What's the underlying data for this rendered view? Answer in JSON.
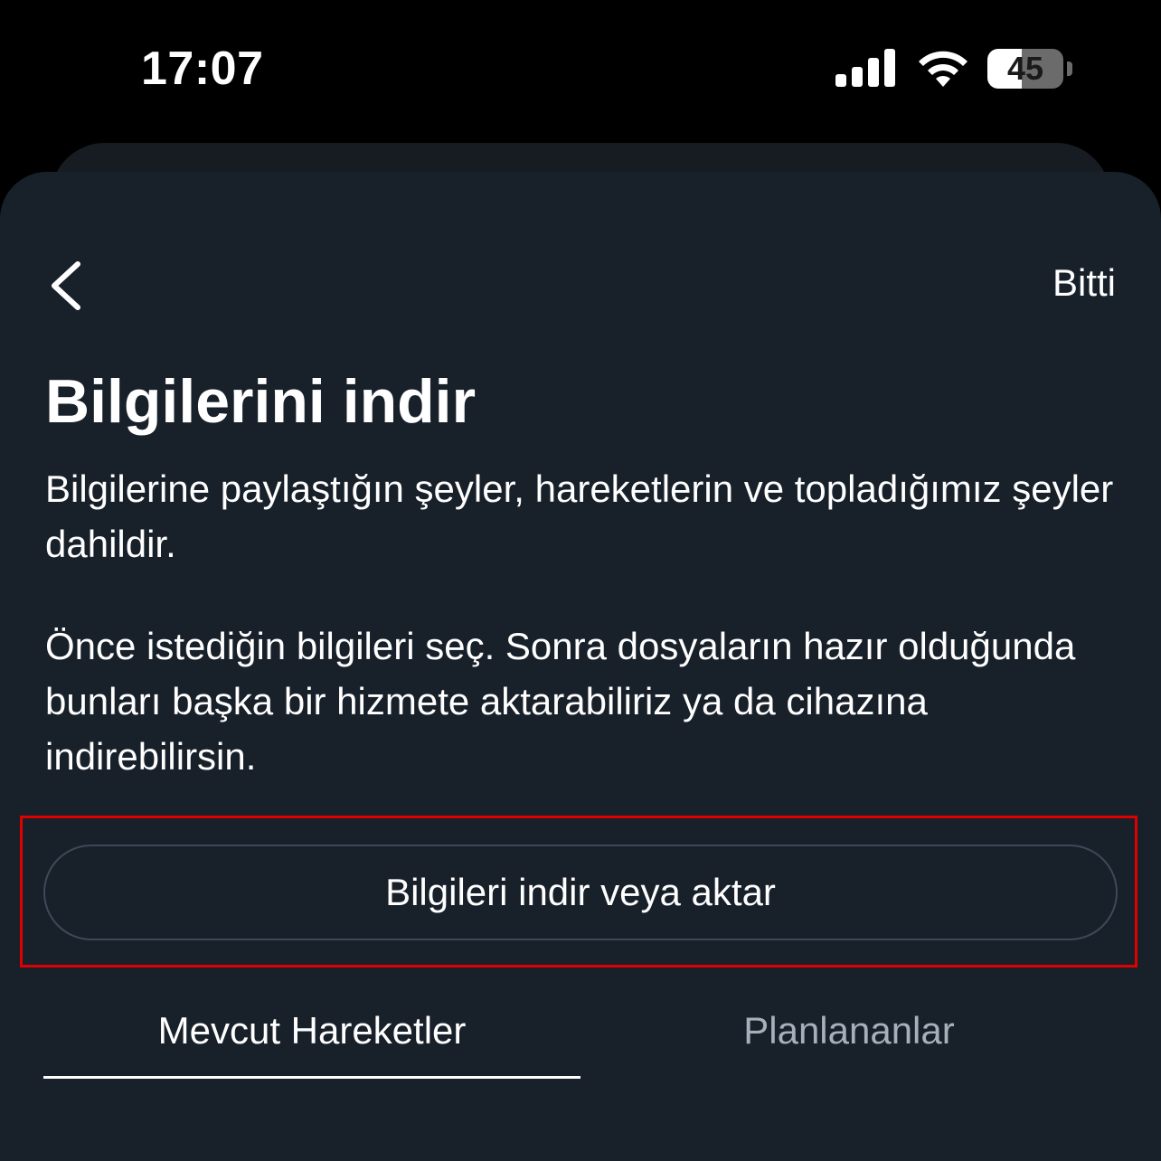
{
  "status_bar": {
    "time": "17:07",
    "battery": "45",
    "icons": [
      "signal-icon",
      "wifi-icon",
      "battery-icon"
    ]
  },
  "header": {
    "back_icon": "chevron-left-icon",
    "done_label": "Bitti"
  },
  "main": {
    "title": "Bilgilerini indir",
    "description_1": "Bilgilerine paylaştığın şeyler, hareketlerin ve topladığımız şeyler dahildir.",
    "description_2": "Önce istediğin bilgileri seç. Sonra dosyaların hazır olduğunda bunları başka bir hizmete aktarabiliriz ya da cihazına indirebilirsin.",
    "primary_button_label": "Bilgileri indir veya aktar"
  },
  "tabs": [
    {
      "label": "Mevcut Hareketler",
      "selected": true
    },
    {
      "label": "Planlananlar",
      "selected": false
    }
  ],
  "colors": {
    "background": "#000000",
    "sheet": "#18202a",
    "highlight": "#e00000",
    "inactive_tab": "#a5b0bb"
  }
}
